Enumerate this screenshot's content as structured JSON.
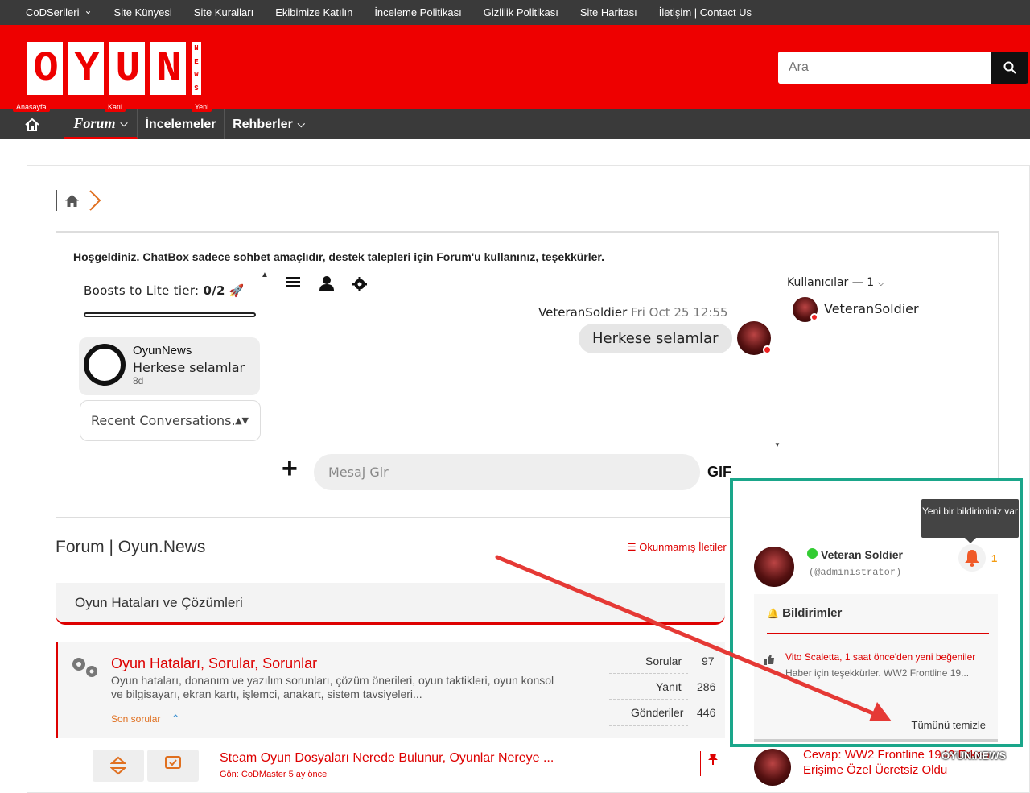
{
  "topnav": {
    "items": [
      "CoDSerileri",
      "Site Künyesi",
      "Site Kuralları",
      "Ekibimize Katılın",
      "İnceleme Politikası",
      "Gizlilik Politikası",
      "Site Haritası",
      "İletişim | Contact Us"
    ]
  },
  "header": {
    "logo_letters": [
      "O",
      "Y",
      "U",
      "N"
    ],
    "logo_news": [
      "N",
      "E",
      "W",
      "S"
    ],
    "search_placeholder": "Ara"
  },
  "mainnav": {
    "home_badge": "Anasayfa",
    "forum_badge": "Katıl",
    "forum_label": "Forum",
    "reviews_badge": "Yeni",
    "reviews_label": "İncelemeler",
    "guides_label": "Rehberler"
  },
  "chat": {
    "welcome": "Hoşgeldiniz. ChatBox sadece sohbet amaçlıdır, destek talepleri için Forum'u kullanınız, teşekkürler.",
    "boost_label": "Boosts to Lite tier: ",
    "boost_value": "0/2",
    "conv_name": "OyunNews",
    "conv_msg": "Herkese selamlar",
    "conv_time": "8d",
    "recent_label": "Recent Conversations.",
    "msg_author": "VeteranSoldier",
    "msg_time": "Fri Oct 25 12:55",
    "msg_text": "Herkese selamlar",
    "users_label": "Kullanıcılar — 1",
    "user_name": "VeteranSoldier",
    "input_placeholder": "Mesaj Gir",
    "gif_label": "GIF"
  },
  "forum": {
    "title": "Forum | Oyun.News",
    "unread": "Okunmamış İletiler",
    "category": "Oyun Hataları ve Çözümleri",
    "subforum_title": "Oyun Hataları, Sorular, Sorunlar",
    "subforum_desc": "Oyun hataları, donanım ve yazılım sorunları, çözüm önerileri, oyun taktikleri, oyun konsol ve bilgisayarı, ekran kartı, işlemci, anakart, sistem tavsiyeleri...",
    "recent_questions": "Son sorular",
    "stats": [
      {
        "label": "Sorular",
        "value": "97"
      },
      {
        "label": "Yanıt",
        "value": "286"
      },
      {
        "label": "Gönderiler",
        "value": "446"
      }
    ],
    "topic_title": "Steam Oyun Dosyaları Nerede Bulunur, Oyunlar Nereye ...",
    "topic_meta": "Gön: CoDMaster  5 ay önce"
  },
  "notifications": {
    "tooltip": "Yeni bir bildiriminiz var",
    "user_name": "Veteran Soldier",
    "user_handle": "(@administrator)",
    "count": "1",
    "heading": "Bildirimler",
    "item_text": "Vito Scaletta, 1 saat önce'den yeni beğeniler",
    "item_excerpt": "Haber için teşekkürler. WW2 Frontline 19...",
    "clear_all": "Tümünü temizle"
  },
  "latest": {
    "reply": "Cevap: WW2 Frontline 1942 Erken Erişime Özel Ücretsiz Oldu",
    "watermark": "OYUN.NEWS"
  },
  "colors": {
    "brand_red": "#ee0000",
    "dark_bar": "#3a3a3a",
    "highlight_green": "#1aa68a",
    "annotation_arrow": "#e53935"
  }
}
